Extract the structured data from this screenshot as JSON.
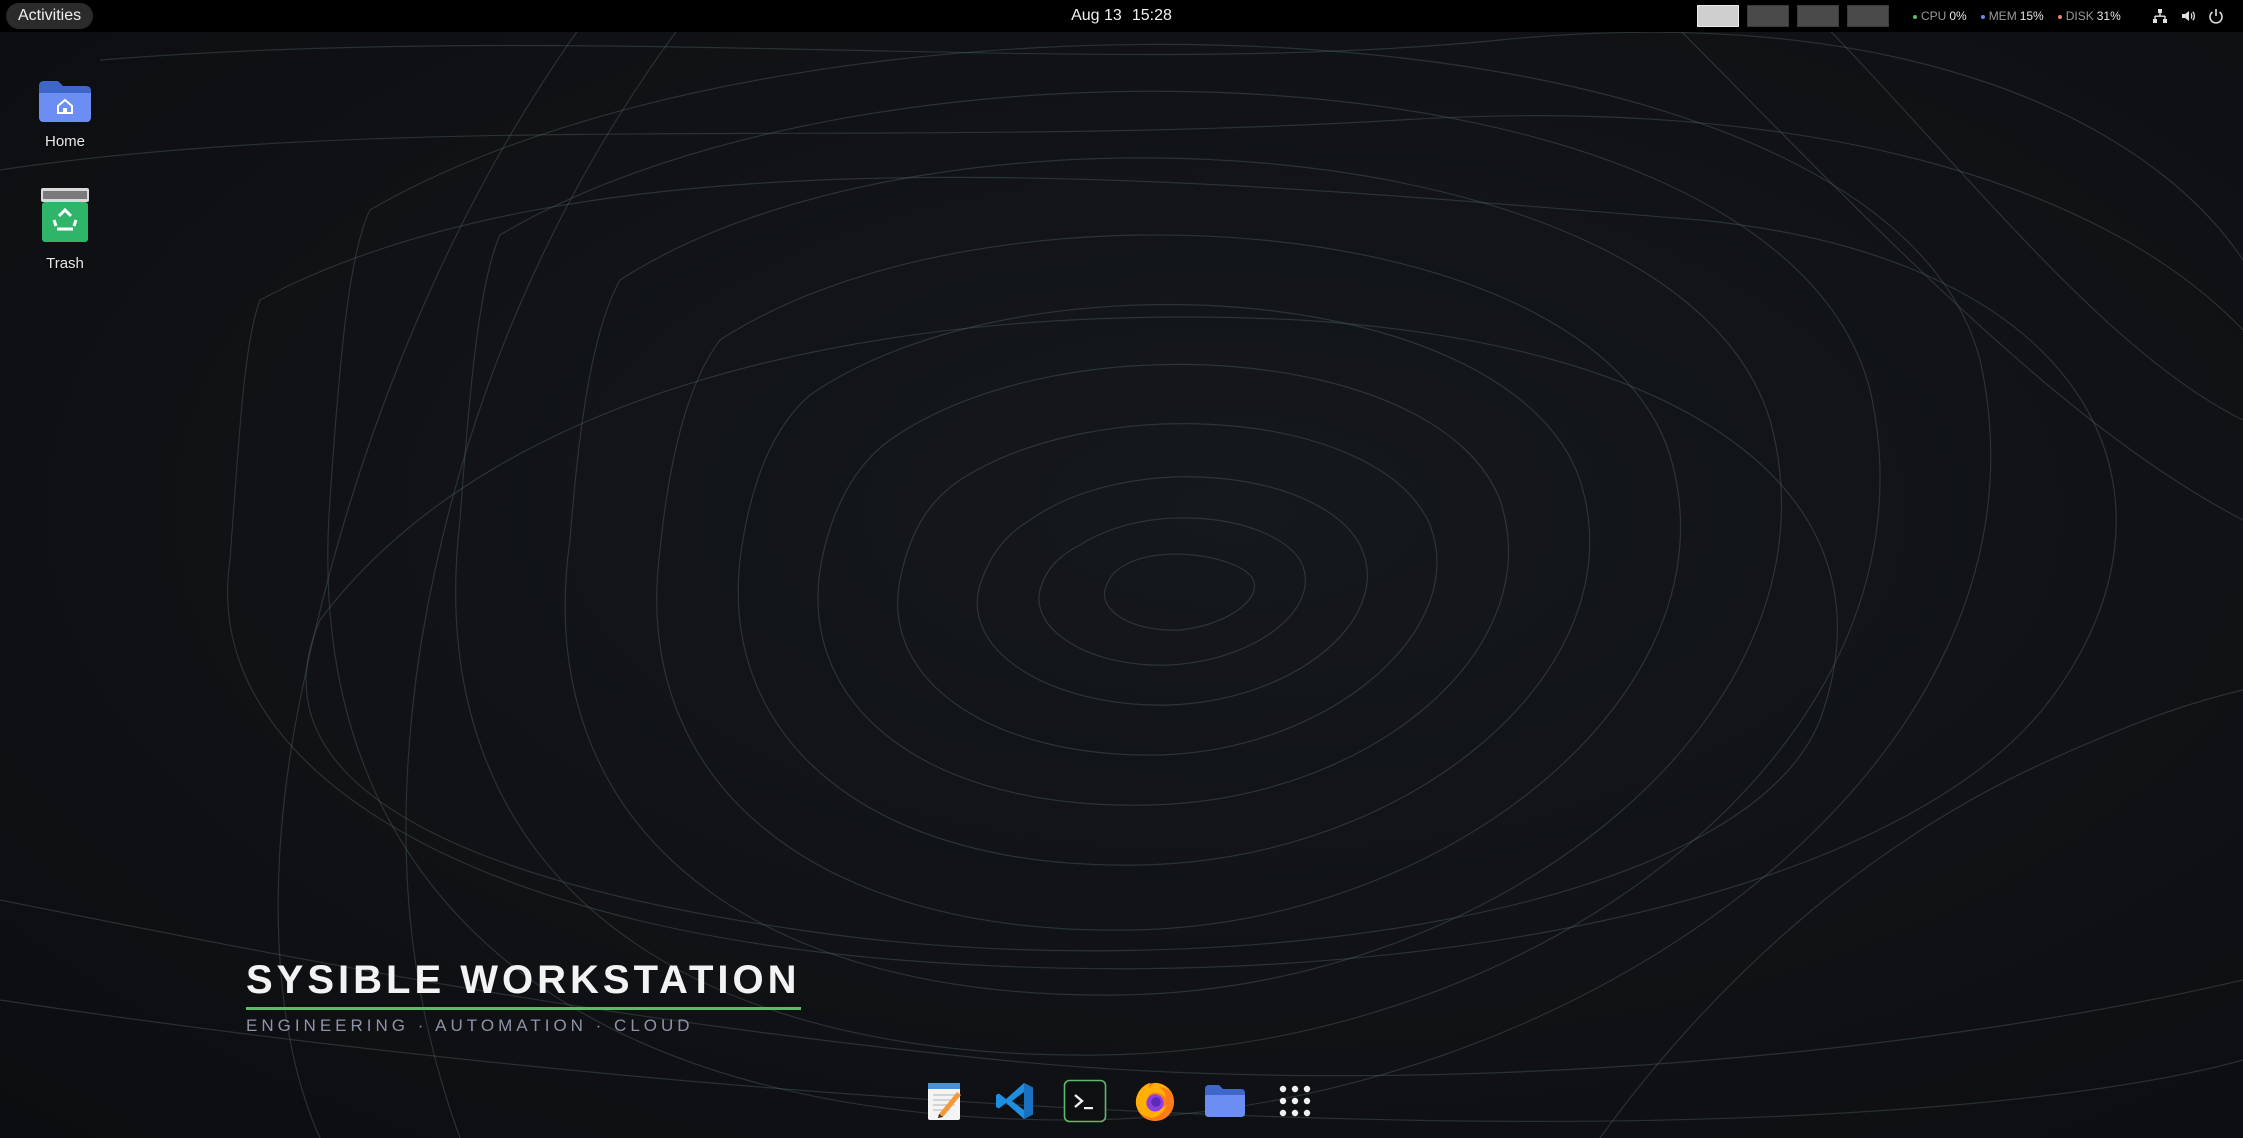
{
  "topbar": {
    "activities_label": "Activities",
    "date": "Aug 13",
    "time": "15:28",
    "workspaces": [
      {
        "index": 1,
        "active": true
      },
      {
        "index": 2,
        "active": false
      },
      {
        "index": 3,
        "active": false
      },
      {
        "index": 4,
        "active": false
      }
    ],
    "system_monitor": {
      "cpu": {
        "label": "CPU",
        "value": "0%",
        "color": "#5fb96a"
      },
      "mem": {
        "label": "MEM",
        "value": "15%",
        "color": "#6a8ce0"
      },
      "disk": {
        "label": "DISK",
        "value": "31%",
        "color": "#e08a5f"
      }
    },
    "tray": [
      "network-icon",
      "volume-icon",
      "power-icon"
    ]
  },
  "desktop_icons": [
    {
      "label": "Home",
      "icon": "home-folder-icon"
    },
    {
      "label": "Trash",
      "icon": "trash-icon"
    }
  ],
  "branding": {
    "title": "SYSIBLE WORKSTATION",
    "tagline": "ENGINEERING · AUTOMATION · CLOUD",
    "accent": "#5fb96a"
  },
  "dock": {
    "apps": [
      "text-editor-icon",
      "vscode-icon",
      "terminal-icon",
      "firefox-icon",
      "files-icon",
      "app-grid-icon"
    ]
  }
}
